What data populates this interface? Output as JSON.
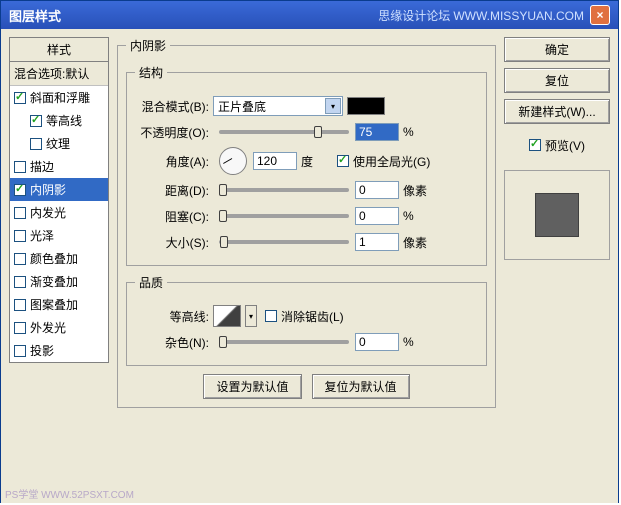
{
  "title": "图层样式",
  "forum_text": "思缘设计论坛",
  "forum_url": "WWW.MISSYUAN.COM",
  "watermark": "PS学堂 WWW.52PSXT.COM",
  "styles": {
    "header": "样式",
    "blend": "混合选项:默认",
    "items": [
      {
        "label": "斜面和浮雕",
        "checked": true,
        "sub": false
      },
      {
        "label": "等高线",
        "checked": true,
        "sub": true
      },
      {
        "label": "纹理",
        "checked": false,
        "sub": true
      },
      {
        "label": "描边",
        "checked": false,
        "sub": false
      },
      {
        "label": "内阴影",
        "checked": true,
        "sub": false,
        "selected": true
      },
      {
        "label": "内发光",
        "checked": false,
        "sub": false
      },
      {
        "label": "光泽",
        "checked": false,
        "sub": false
      },
      {
        "label": "颜色叠加",
        "checked": false,
        "sub": false
      },
      {
        "label": "渐变叠加",
        "checked": false,
        "sub": false
      },
      {
        "label": "图案叠加",
        "checked": false,
        "sub": false
      },
      {
        "label": "外发光",
        "checked": false,
        "sub": false
      },
      {
        "label": "投影",
        "checked": false,
        "sub": false
      }
    ]
  },
  "panel_title": "内阴影",
  "structure": {
    "legend": "结构",
    "blend_mode_label": "混合模式(B):",
    "blend_mode_value": "正片叠底",
    "opacity_label": "不透明度(O):",
    "opacity_value": "75",
    "opacity_unit": "%",
    "angle_label": "角度(A):",
    "angle_value": "120",
    "angle_unit": "度",
    "global_light": "使用全局光(G)",
    "global_light_checked": true,
    "distance_label": "距离(D):",
    "distance_value": "0",
    "distance_unit": "像素",
    "choke_label": "阻塞(C):",
    "choke_value": "0",
    "choke_unit": "%",
    "size_label": "大小(S):",
    "size_value": "1",
    "size_unit": "像素"
  },
  "quality": {
    "legend": "品质",
    "contour_label": "等高线:",
    "antialias": "消除锯齿(L)",
    "antialias_checked": false,
    "noise_label": "杂色(N):",
    "noise_value": "0",
    "noise_unit": "%"
  },
  "buttons": {
    "make_default": "设置为默认值",
    "reset_default": "复位为默认值",
    "ok": "确定",
    "cancel": "复位",
    "new_style": "新建样式(W)...",
    "preview": "预览(V)"
  }
}
